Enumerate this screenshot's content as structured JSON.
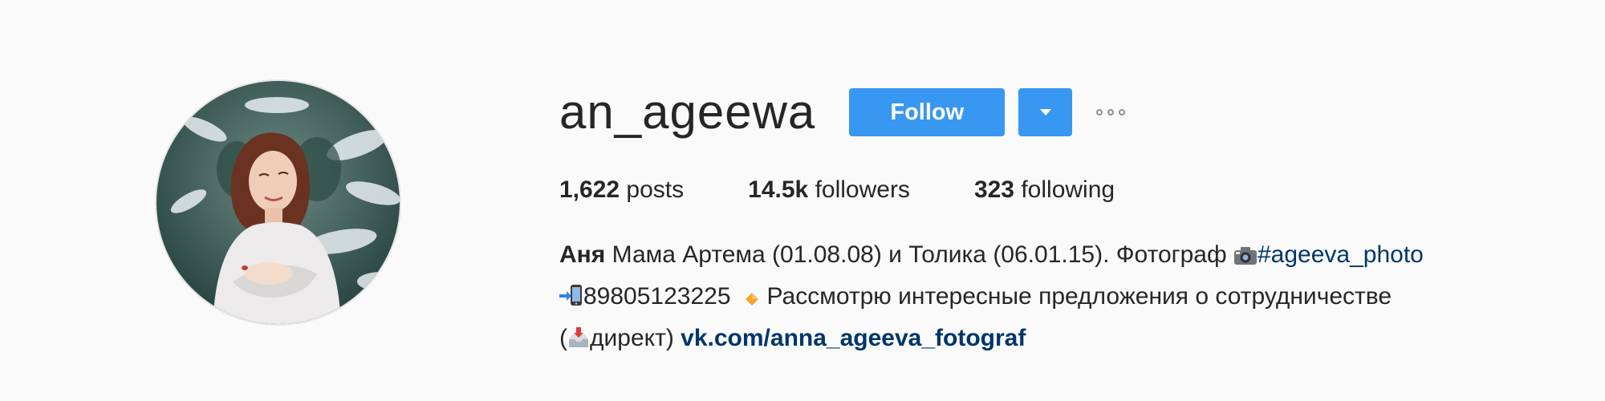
{
  "profile": {
    "username": "an_ageewa",
    "follow_label": "Follow",
    "dropdown_icon": "caret-down-icon",
    "more_icon": "more-options-icon",
    "avatar_icon": "profile-photo",
    "stats": {
      "posts_count": "1,622",
      "posts_label": "posts",
      "followers_count": "14.5k",
      "followers_label": "followers",
      "following_count": "323",
      "following_label": "following"
    },
    "bio": {
      "name": "Аня",
      "line1_text": " Мама Артема (01.08.08) и Толика (06.01.15). Фотограф ",
      "hashtag": "#ageeva_photo",
      "phone": "89805123225",
      "offer_text": " Рассмотрю интересные предложения о сотрудничестве",
      "open_paren": "(",
      "direct_text": "директ) ",
      "link": "vk.com/anna_ageeva_fotograf"
    }
  },
  "colors": {
    "background": "#fafafa",
    "text": "#262626",
    "button": "#3897f0",
    "link": "#003569",
    "muted": "#8e8e8e"
  }
}
